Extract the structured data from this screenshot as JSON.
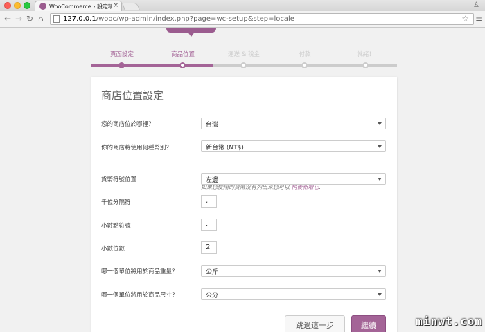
{
  "browser": {
    "tab_title": "WooCommerce › 設定精靈",
    "url_host": "127.0.0.1",
    "url_path": "/wooc/wp-admin/index.php?page=wc-setup&step=locale"
  },
  "steps": [
    {
      "label": "頁面設定",
      "state": "done"
    },
    {
      "label": "商品位置",
      "state": "active"
    },
    {
      "label": "運送 & 稅金",
      "state": "todo"
    },
    {
      "label": "付款",
      "state": "todo"
    },
    {
      "label": "就緒！",
      "state": "todo"
    }
  ],
  "form": {
    "title": "商店位置設定",
    "location_label": "您的商店位於哪裡？",
    "location_value": "台灣",
    "currency_label": "你的商店將使用何種幣別？",
    "currency_value": "新台幣 (NT$)",
    "currency_help": "如果您使用的貨幣沒有列出來您可以 ",
    "currency_help_link": "稍後新增它",
    "currency_help_end": ".",
    "currency_pos_label": "貨幣符號位置",
    "currency_pos_value": "左邊",
    "thousand_sep_label": "千位分隔符",
    "thousand_sep_value": ",",
    "decimal_sep_label": "小數點符號",
    "decimal_sep_value": ".",
    "num_decimals_label": "小數位數",
    "num_decimals_value": "2",
    "weight_unit_label": "哪一個單位將用於商品重量？",
    "weight_unit_value": "公斤",
    "dimension_unit_label": "哪一個單位將用於商品尺寸？",
    "dimension_unit_value": "公分",
    "skip_label": "跳過這一步",
    "continue_label": "繼續"
  },
  "watermark": "minwt.com",
  "colors": {
    "accent": "#a46497"
  }
}
